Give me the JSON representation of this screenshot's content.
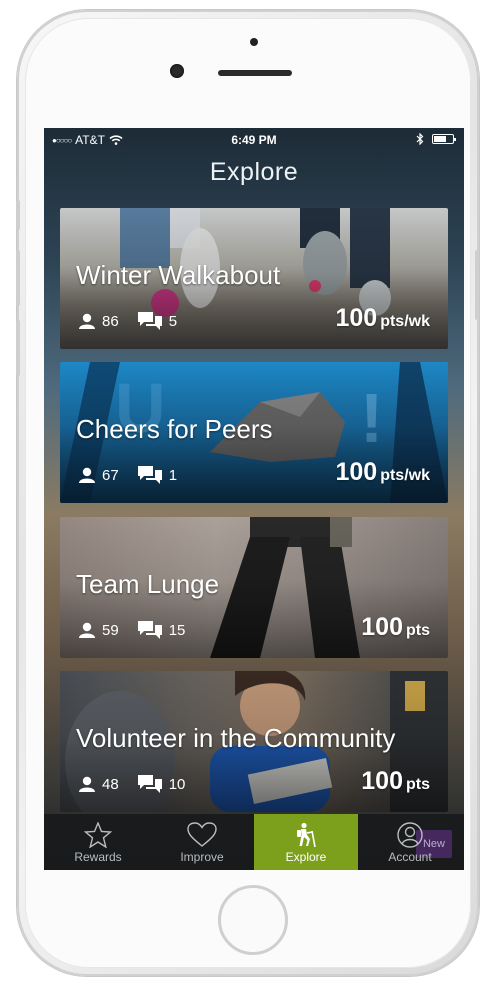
{
  "status_bar": {
    "signal": "●○○○○",
    "carrier": "AT&T",
    "time": "6:49 PM"
  },
  "header": {
    "title": "Explore"
  },
  "challenges": [
    {
      "title": "Winter Walkabout",
      "participants": "86",
      "comments": "5",
      "points": "100",
      "unit": "pts/wk"
    },
    {
      "title": "Cheers for Peers",
      "participants": "67",
      "comments": "1",
      "points": "100",
      "unit": "pts/wk"
    },
    {
      "title": "Team Lunge",
      "participants": "59",
      "comments": "15",
      "points": "100",
      "unit": "pts"
    },
    {
      "title": "Volunteer in the Community",
      "participants": "48",
      "comments": "10",
      "points": "100",
      "unit": "pts"
    }
  ],
  "tabs": [
    {
      "label": "Rewards",
      "icon": "star-icon"
    },
    {
      "label": "Improve",
      "icon": "heart-icon"
    },
    {
      "label": "Explore",
      "icon": "hiker-icon",
      "active": true
    },
    {
      "label": "Account",
      "icon": "person-icon"
    }
  ],
  "account_badge": "New",
  "colors": {
    "active_tab": "#7ca01c",
    "tab_bar": "#181a1c",
    "badge": "#4a2a66"
  }
}
